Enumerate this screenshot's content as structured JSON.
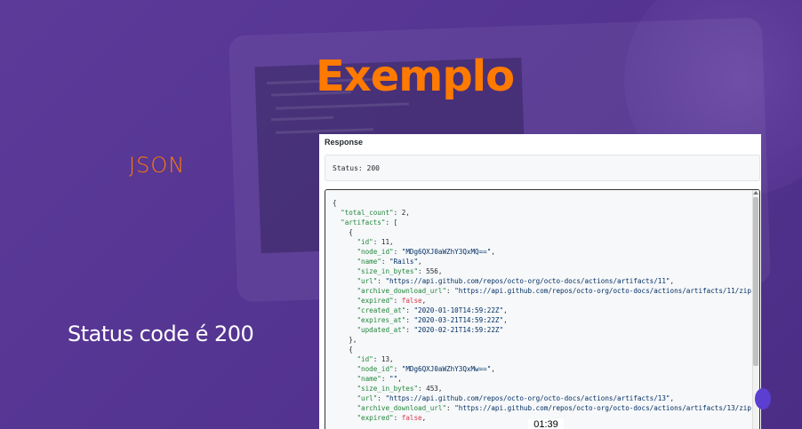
{
  "slide": {
    "title": "Exemplo",
    "label_json": "JSON",
    "label_status": "Status code é 200"
  },
  "response": {
    "header": "Response",
    "status_text": "Status: 200",
    "body_lines": [
      [
        {
          "t": "n",
          "v": "{"
        }
      ],
      [
        {
          "t": "n",
          "v": "  "
        },
        {
          "t": "k",
          "v": "\"total_count\""
        },
        {
          "t": "n",
          "v": ": 2,"
        }
      ],
      [
        {
          "t": "n",
          "v": "  "
        },
        {
          "t": "k",
          "v": "\"artifacts\""
        },
        {
          "t": "n",
          "v": ": ["
        }
      ],
      [
        {
          "t": "n",
          "v": "    {"
        }
      ],
      [
        {
          "t": "n",
          "v": "      "
        },
        {
          "t": "k",
          "v": "\"id\""
        },
        {
          "t": "n",
          "v": ": 11,"
        }
      ],
      [
        {
          "t": "n",
          "v": "      "
        },
        {
          "t": "k",
          "v": "\"node_id\""
        },
        {
          "t": "n",
          "v": ": "
        },
        {
          "t": "s",
          "v": "\"MDg6QXJ0aWZhY3QxMQ==\""
        },
        {
          "t": "n",
          "v": ","
        }
      ],
      [
        {
          "t": "n",
          "v": "      "
        },
        {
          "t": "k",
          "v": "\"name\""
        },
        {
          "t": "n",
          "v": ": "
        },
        {
          "t": "s",
          "v": "\"Rails\""
        },
        {
          "t": "n",
          "v": ","
        }
      ],
      [
        {
          "t": "n",
          "v": "      "
        },
        {
          "t": "k",
          "v": "\"size_in_bytes\""
        },
        {
          "t": "n",
          "v": ": 556,"
        }
      ],
      [
        {
          "t": "n",
          "v": "      "
        },
        {
          "t": "k",
          "v": "\"url\""
        },
        {
          "t": "n",
          "v": ": "
        },
        {
          "t": "s",
          "v": "\"https://api.github.com/repos/octo-org/octo-docs/actions/artifacts/11\""
        },
        {
          "t": "n",
          "v": ","
        }
      ],
      [
        {
          "t": "n",
          "v": "      "
        },
        {
          "t": "k",
          "v": "\"archive_download_url\""
        },
        {
          "t": "n",
          "v": ": "
        },
        {
          "t": "s",
          "v": "\"https://api.github.com/repos/octo-org/octo-docs/actions/artifacts/11/zip\""
        }
      ],
      [
        {
          "t": "n",
          "v": "      "
        },
        {
          "t": "k",
          "v": "\"expired\""
        },
        {
          "t": "n",
          "v": ": "
        },
        {
          "t": "f",
          "v": "false"
        },
        {
          "t": "n",
          "v": ","
        }
      ],
      [
        {
          "t": "n",
          "v": "      "
        },
        {
          "t": "k",
          "v": "\"created_at\""
        },
        {
          "t": "n",
          "v": ": "
        },
        {
          "t": "s",
          "v": "\"2020-01-10T14:59:22Z\""
        },
        {
          "t": "n",
          "v": ","
        }
      ],
      [
        {
          "t": "n",
          "v": "      "
        },
        {
          "t": "k",
          "v": "\"expires_at\""
        },
        {
          "t": "n",
          "v": ": "
        },
        {
          "t": "s",
          "v": "\"2020-03-21T14:59:22Z\""
        },
        {
          "t": "n",
          "v": ","
        }
      ],
      [
        {
          "t": "n",
          "v": "      "
        },
        {
          "t": "k",
          "v": "\"updated_at\""
        },
        {
          "t": "n",
          "v": ": "
        },
        {
          "t": "s",
          "v": "\"2020-02-21T14:59:22Z\""
        }
      ],
      [
        {
          "t": "n",
          "v": "    },"
        }
      ],
      [
        {
          "t": "n",
          "v": "    {"
        }
      ],
      [
        {
          "t": "n",
          "v": "      "
        },
        {
          "t": "k",
          "v": "\"id\""
        },
        {
          "t": "n",
          "v": ": 13,"
        }
      ],
      [
        {
          "t": "n",
          "v": "      "
        },
        {
          "t": "k",
          "v": "\"node_id\""
        },
        {
          "t": "n",
          "v": ": "
        },
        {
          "t": "s",
          "v": "\"MDg6QXJ0aWZhY3QxMw==\""
        },
        {
          "t": "n",
          "v": ","
        }
      ],
      [
        {
          "t": "n",
          "v": "      "
        },
        {
          "t": "k",
          "v": "\"name\""
        },
        {
          "t": "n",
          "v": ": "
        },
        {
          "t": "s",
          "v": "\"\""
        },
        {
          "t": "n",
          "v": ","
        }
      ],
      [
        {
          "t": "n",
          "v": "      "
        },
        {
          "t": "k",
          "v": "\"size_in_bytes\""
        },
        {
          "t": "n",
          "v": ": 453,"
        }
      ],
      [
        {
          "t": "n",
          "v": "      "
        },
        {
          "t": "k",
          "v": "\"url\""
        },
        {
          "t": "n",
          "v": ": "
        },
        {
          "t": "s",
          "v": "\"https://api.github.com/repos/octo-org/octo-docs/actions/artifacts/13\""
        },
        {
          "t": "n",
          "v": ","
        }
      ],
      [
        {
          "t": "n",
          "v": "      "
        },
        {
          "t": "k",
          "v": "\"archive_download_url\""
        },
        {
          "t": "n",
          "v": ": "
        },
        {
          "t": "s",
          "v": "\"https://api.github.com/repos/octo-org/octo-docs/actions/artifacts/13/zip\""
        }
      ],
      [
        {
          "t": "n",
          "v": "      "
        },
        {
          "t": "k",
          "v": "\"expired\""
        },
        {
          "t": "n",
          "v": ": "
        },
        {
          "t": "f",
          "v": "false"
        },
        {
          "t": "n",
          "v": ","
        }
      ]
    ]
  },
  "player": {
    "timecode": "01:39"
  },
  "colors": {
    "accent": "#ff7a00",
    "background": "#553592",
    "json_key": "#22863a",
    "json_string": "#032f62",
    "json_bool": "#d73a49"
  }
}
